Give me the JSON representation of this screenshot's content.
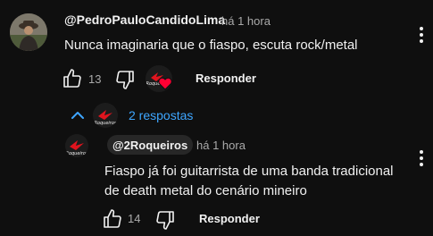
{
  "comment": {
    "author": "@PedroPauloCandidoLima",
    "time": "há 1 hora",
    "text": "Nunca imaginaria que o fiaspo, escuta rock/metal",
    "likes": "13",
    "reply_label": "Responder",
    "creator_heart": "heart-icon"
  },
  "replies_toggle": {
    "label": "2 respostas"
  },
  "reply": {
    "author": "@2Roqueiros",
    "time": "há 1 hora",
    "text": "Fiaspo já foi guitarrista de uma banda tradicional de death metal do cenário mineiro",
    "likes": "14",
    "reply_label": "Responder"
  },
  "logo_text": "Roqueiros",
  "colors": {
    "background": "#0f0f0f",
    "link": "#3ea6ff",
    "heart": "#ff0033",
    "logo_red": "#e0141e"
  }
}
